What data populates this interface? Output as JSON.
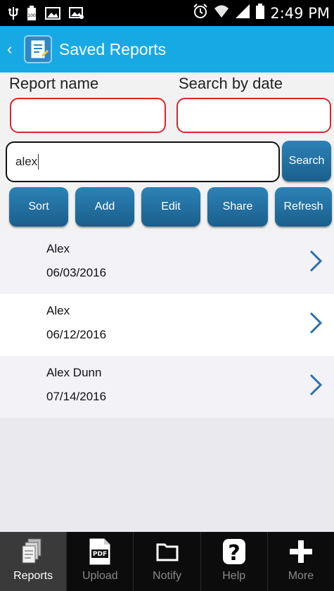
{
  "status_bar": {
    "time": "2:49 PM",
    "left_icons": [
      "usb-icon",
      "battery-100-icon",
      "image-icon",
      "gallery-icon"
    ],
    "right_icons": [
      "alarm-icon",
      "wifi-icon",
      "signal-icon",
      "battery-icon"
    ]
  },
  "header": {
    "title": "Saved Reports",
    "back_icon": "chevron-left-icon",
    "app_icon": "report-icon",
    "color": "#17a9e4"
  },
  "search": {
    "report_name_label": "Report name",
    "search_by_date_label": "Search by date",
    "report_name_value": "",
    "date_value": "",
    "query": "alex",
    "search_button": "Search"
  },
  "toolbar": {
    "sort": "Sort",
    "add": "Add",
    "edit": "Edit",
    "share": "Share",
    "refresh": "Refresh"
  },
  "reports": [
    {
      "name": "Alex",
      "date": "06/03/2016"
    },
    {
      "name": "Alex",
      "date": "06/12/2016"
    },
    {
      "name": "Alex Dunn",
      "date": "07/14/2016"
    }
  ],
  "tabs": [
    {
      "label": "Reports",
      "icon": "reports-icon",
      "active": true
    },
    {
      "label": "Upload",
      "icon": "pdf-icon",
      "active": false
    },
    {
      "label": "Notify",
      "icon": "folder-icon",
      "active": false
    },
    {
      "label": "Help",
      "icon": "help-icon",
      "active": false
    },
    {
      "label": "More",
      "icon": "plus-icon",
      "active": false
    }
  ],
  "colors": {
    "accent": "#17a9e4",
    "button": "#1e6d9e",
    "field_border": "#d8262b",
    "chevron": "#2a6fb0"
  }
}
